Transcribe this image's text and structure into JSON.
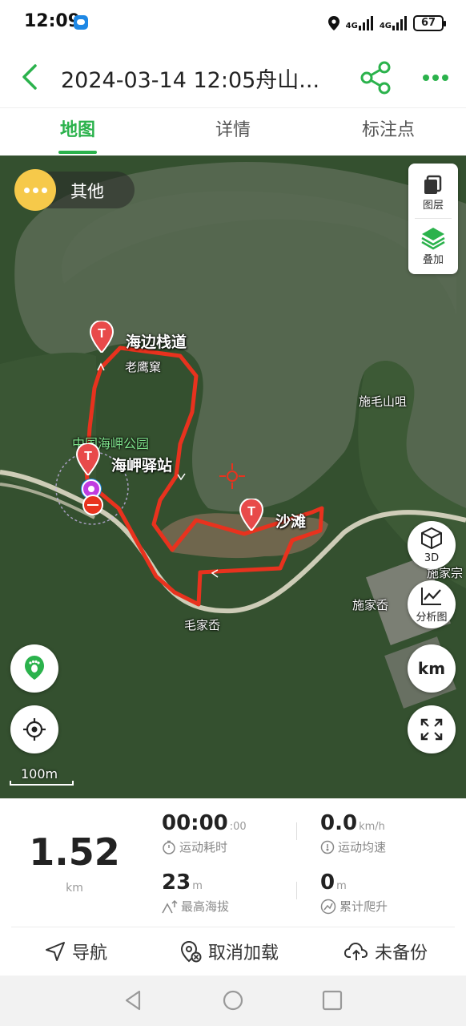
{
  "status_bar": {
    "time": "12:09",
    "net1": "4G",
    "net2": "4G",
    "battery": "67"
  },
  "header": {
    "title": "2024-03-14 12:05舟山...",
    "accent": "#2bb24c"
  },
  "tabs": [
    {
      "label": "地图",
      "active": true
    },
    {
      "label": "详情",
      "active": false
    },
    {
      "label": "标注点",
      "active": false
    }
  ],
  "map": {
    "other_label": "其他",
    "layer_label": "图层",
    "overlay_label": "叠加",
    "btn_3d": "3D",
    "btn_analysis": "分析图",
    "btn_unit": "km",
    "scale_label": "100m",
    "place_labels": {
      "laoyingke": "老鹰窠",
      "park": "中国海岬公园",
      "shimaoshan": "施毛山咀",
      "shijiaxian": "施家岙",
      "maojiaxian": "毛家岙",
      "shijiazong": "施家宗"
    },
    "waypoints": {
      "wp1": "海边栈道",
      "wp2": "海岬驿站",
      "wp3": "沙滩"
    },
    "track_color": "#e8321e"
  },
  "stats": {
    "distance": "1.52",
    "distance_unit": "km",
    "duration": "00:00",
    "duration_sec": ":00",
    "duration_caption": "运动耗时",
    "avg_speed": "0.0",
    "avg_speed_unit": "km/h",
    "avg_speed_caption": "运动均速",
    "max_alt": "23",
    "max_alt_unit": "m",
    "max_alt_caption": "最高海拔",
    "climb": "0",
    "climb_unit": "m",
    "climb_caption": "累计爬升"
  },
  "actions": {
    "navigate": "导航",
    "cancel_load": "取消加载",
    "backup": "未备份"
  }
}
